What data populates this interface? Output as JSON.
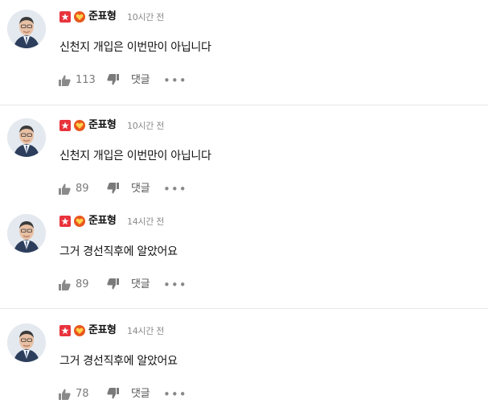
{
  "comments": [
    {
      "author": "준표형",
      "time": "10시간 전",
      "text": "신천지 개입은 이번만이 아닙니다",
      "likes": "113",
      "reply_label": "댓글",
      "more_label": "•••"
    },
    {
      "author": "준표형",
      "time": "10시간 전",
      "text": "신천지 개입은 이번만이 아닙니다",
      "likes": "89",
      "reply_label": "댓글",
      "more_label": "•••"
    },
    {
      "author": "준표형",
      "time": "14시간 전",
      "text": "그거 경선직후에 알았어요",
      "likes": "89",
      "reply_label": "댓글",
      "more_label": "•••"
    },
    {
      "author": "준표형",
      "time": "14시간 전",
      "text": "그거 경선직후에 알았어요",
      "likes": "78",
      "reply_label": "댓글",
      "more_label": "•••"
    }
  ],
  "icons": {
    "like": "thumbs-up-icon",
    "dislike": "thumbs-down-icon",
    "star_badge": "star-badge-icon",
    "heart_badge": "heart-badge-icon"
  },
  "colors": {
    "star_badge": "#e8333d",
    "heart_badge": "#e8571e",
    "icon_gray": "#8a8a8a"
  }
}
